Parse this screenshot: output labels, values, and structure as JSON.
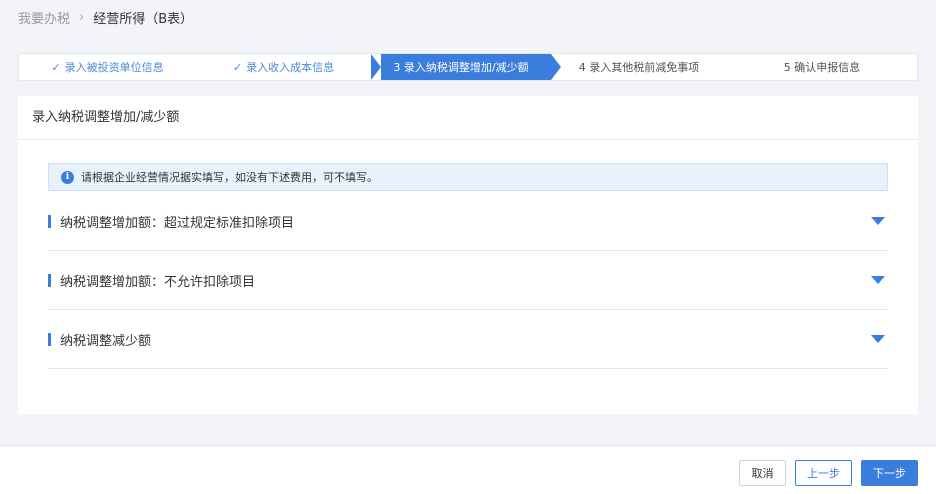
{
  "breadcrumb": {
    "parent": "我要办税",
    "current": "经营所得（B表）"
  },
  "steps": [
    {
      "label": "录入被投资单位信息",
      "status": "done"
    },
    {
      "label": "录入收入成本信息",
      "status": "done"
    },
    {
      "label": "3 录入纳税调整增加/减少额",
      "status": "active"
    },
    {
      "label": "4 录入其他税前减免事项",
      "status": "pending"
    },
    {
      "label": "5 确认申报信息",
      "status": "pending"
    }
  ],
  "card": {
    "title": "录入纳税调整增加/减少额",
    "notice": "请根据企业经营情况据实填写，如没有下述费用，可不填写。",
    "sections": [
      {
        "label": "纳税调整增加额：超过规定标准扣除项目"
      },
      {
        "label": "纳税调整增加额：不允许扣除项目"
      },
      {
        "label": "纳税调整减少额"
      }
    ]
  },
  "footer": {
    "cancel_label": "取消",
    "prev_label": "上一步",
    "next_label": "下一步"
  },
  "colors": {
    "accent": "#3b7ddd",
    "notice_bg": "#e8f2fd"
  }
}
